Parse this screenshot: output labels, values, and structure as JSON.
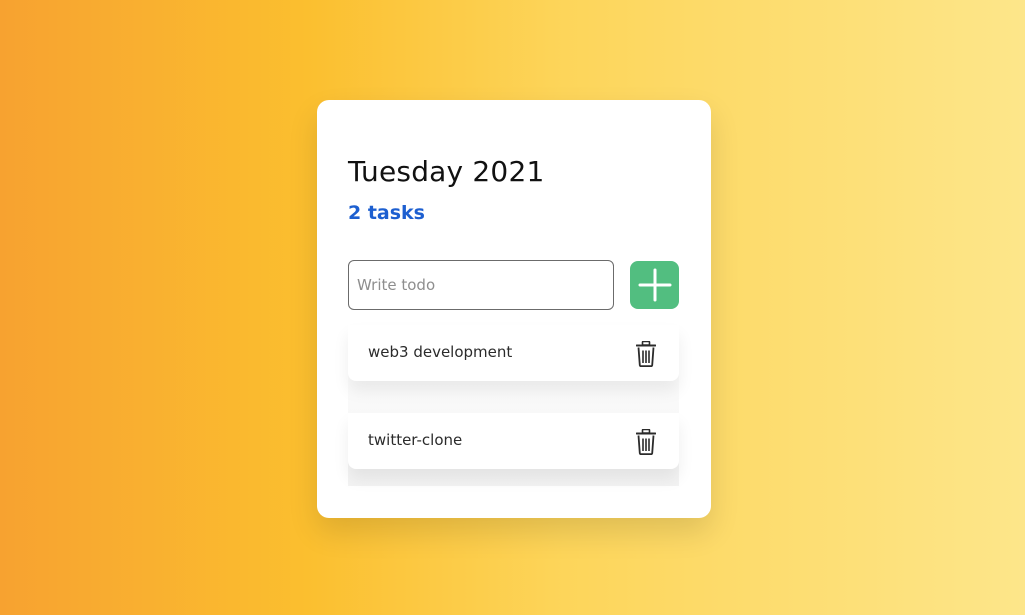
{
  "header": {
    "title": "Tuesday 2021",
    "task_count": "2 tasks"
  },
  "input": {
    "placeholder": "Write todo",
    "value": ""
  },
  "add_button": {
    "icon": "plus-icon",
    "color": "#52be80"
  },
  "todos": [
    {
      "label": "web3 development",
      "icon": "trash-icon"
    },
    {
      "label": "twitter-clone",
      "icon": "trash-icon"
    }
  ],
  "colors": {
    "accent": "#1d5fd0",
    "add": "#52be80"
  }
}
